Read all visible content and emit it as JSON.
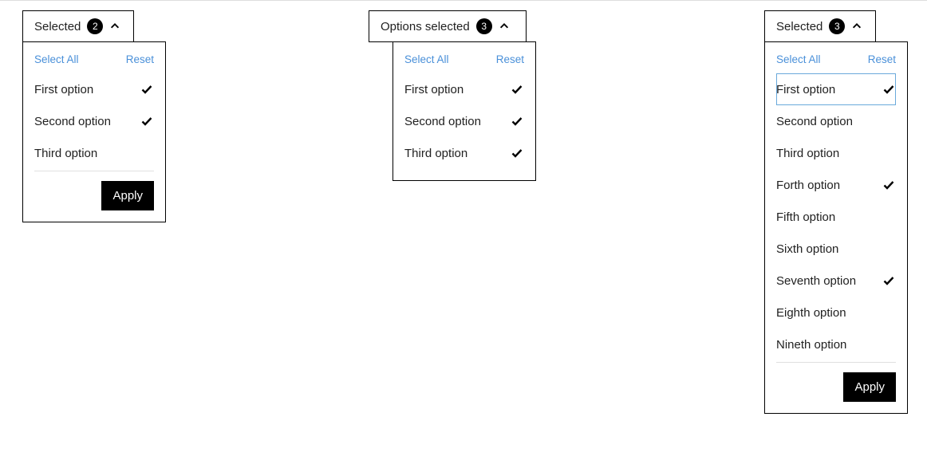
{
  "common": {
    "select_all": "Select All",
    "reset": "Reset",
    "apply": "Apply"
  },
  "dropdown1": {
    "header_label": "Selected",
    "count": "2",
    "options": [
      {
        "label": "First option",
        "checked": true
      },
      {
        "label": "Second option",
        "checked": true
      },
      {
        "label": "Third option",
        "checked": false
      }
    ]
  },
  "dropdown2": {
    "header_label": "Options selected",
    "count": "3",
    "options": [
      {
        "label": "First option",
        "checked": true
      },
      {
        "label": "Second option",
        "checked": true
      },
      {
        "label": "Third option",
        "checked": true
      }
    ]
  },
  "dropdown3": {
    "header_label": "Selected",
    "count": "3",
    "options": [
      {
        "label": "First option",
        "checked": true,
        "highlight": true
      },
      {
        "label": "Second option",
        "checked": false
      },
      {
        "label": "Third option",
        "checked": false
      },
      {
        "label": "Forth option",
        "checked": true
      },
      {
        "label": "Fifth option",
        "checked": false
      },
      {
        "label": "Sixth option",
        "checked": false
      },
      {
        "label": "Seventh option",
        "checked": true
      },
      {
        "label": "Eighth option",
        "checked": false
      },
      {
        "label": "Nineth option",
        "checked": false
      }
    ]
  }
}
